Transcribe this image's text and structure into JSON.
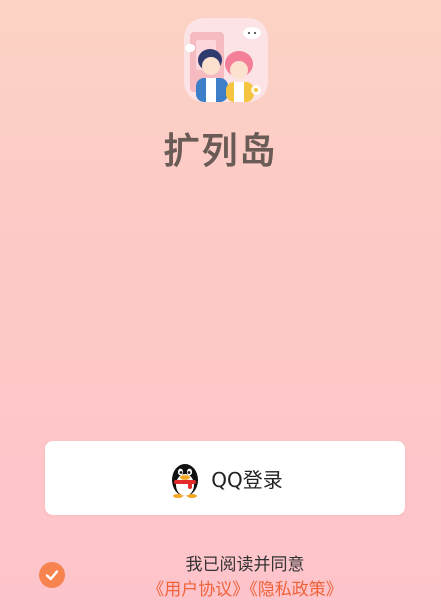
{
  "app": {
    "name": "扩列岛",
    "logo_icon": "couple-illustration-icon"
  },
  "login": {
    "qq_button_label": "QQ登录",
    "qq_icon": "qq-penguin-icon"
  },
  "agreement": {
    "checked": true,
    "check_icon": "checkmark-icon",
    "statement": "我已阅读并同意",
    "user_agreement_link": "《用户协议》",
    "privacy_policy_link": "《隐私政策》"
  },
  "colors": {
    "accent": "#f7834f",
    "link": "#f0623a",
    "title": "#6b5b56",
    "background_top": "#fcd3c4",
    "background_bottom": "#fec4cb"
  }
}
